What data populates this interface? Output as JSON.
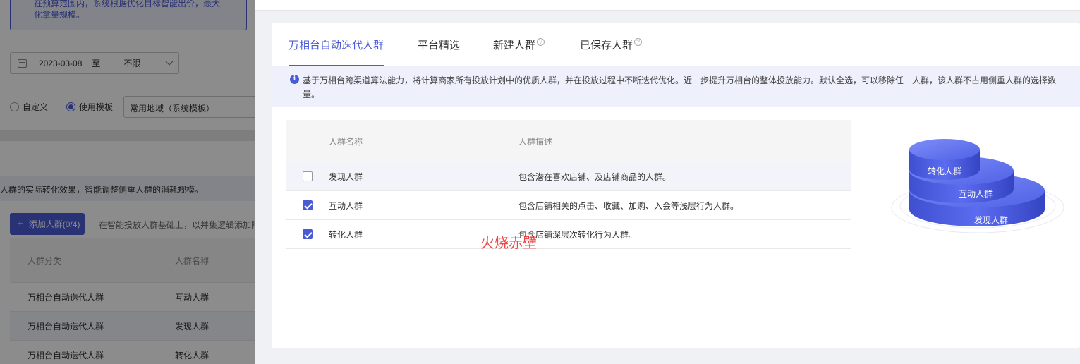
{
  "background_page": {
    "hint_text": "在预算范围内，系统根据优化目标智能出价，最大化拿量规模。",
    "date_start": "2023-03-08",
    "date_sep": "至",
    "date_end": "不限",
    "radio_custom": "自定义",
    "radio_template": "使用模板",
    "template_value": "常用地域（系统模板）",
    "info_text": "人群的实际转化效果，智能调整侧重人群的消耗规模。",
    "add_button": "添加人群(0/4)",
    "add_note": "在智能投放人群基础上，以并集逻辑添加附",
    "table_headers": [
      "人群分类",
      "人群名称"
    ],
    "rows": [
      {
        "category": "万相台自动迭代人群",
        "name": "互动人群"
      },
      {
        "category": "万相台自动迭代人群",
        "name": "发现人群"
      },
      {
        "category": "万相台自动迭代人群",
        "name": "转化人群"
      }
    ]
  },
  "tabs": [
    {
      "label": "万相台自动迭代人群",
      "active": true,
      "help": false
    },
    {
      "label": "平台精选",
      "active": false,
      "help": false
    },
    {
      "label": "新建人群",
      "active": false,
      "help": true
    },
    {
      "label": "已保存人群",
      "active": false,
      "help": true
    }
  ],
  "help_glyph": "?",
  "info_glyph": "i",
  "notice": "基于万相台跨渠道算法能力，将计算商家所有投放计划中的优质人群，并在投放过程中不断迭代优化。近一步提升万相台的整体投放能力。默认全选，可以移除任一人群，该人群不占用侧重人群的选择数量。",
  "table": {
    "headers": {
      "name": "人群名称",
      "desc": "人群描述"
    },
    "rows": [
      {
        "name": "发现人群",
        "desc": "包含潜在喜欢店铺、及店铺商品的人群。",
        "checked": false
      },
      {
        "name": "互动人群",
        "desc": "包含店铺相关的点击、收藏、加购、入会等浅层行为人群。",
        "checked": true
      },
      {
        "name": "转化人群",
        "desc": "包含店铺深层次转化行为人群。",
        "checked": true
      }
    ]
  },
  "watermark": "火烧赤壁",
  "pyramid": {
    "top": "转化人群",
    "middle": "互动人群",
    "bottom": "发现人群"
  },
  "colors": {
    "accent": "#4b5bd6",
    "notice_bg": "#eef0fc",
    "watermark": "#e33333"
  }
}
